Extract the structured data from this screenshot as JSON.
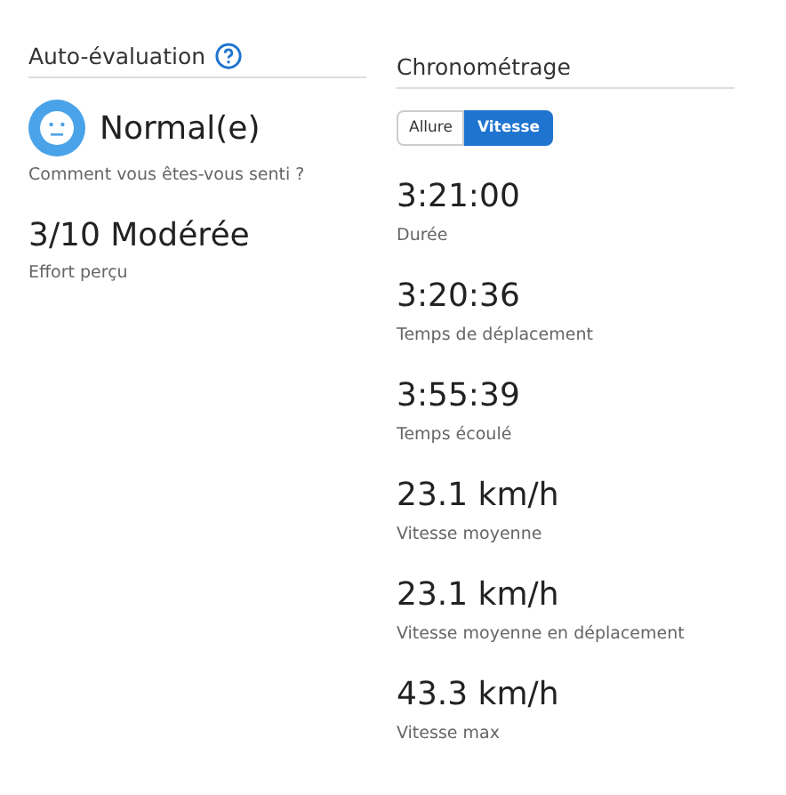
{
  "self_evaluation": {
    "title": "Auto-évaluation",
    "feeling": {
      "value": "Normal(e)",
      "label": "Comment vous êtes-vous senti ?"
    },
    "effort": {
      "value": "3/10 Modérée",
      "label": "Effort perçu"
    }
  },
  "timing": {
    "title": "Chronométrage",
    "toggle": [
      {
        "label": "Allure",
        "selected": false
      },
      {
        "label": "Vitesse",
        "selected": true
      }
    ],
    "stats": [
      {
        "value": "3:21:00",
        "label": "Durée"
      },
      {
        "value": "3:20:36",
        "label": "Temps de déplacement"
      },
      {
        "value": "3:55:39",
        "label": "Temps écoulé"
      },
      {
        "value": "23.1 km/h",
        "label": "Vitesse moyenne"
      },
      {
        "value": "23.1 km/h",
        "label": "Vitesse moyenne en déplacement"
      },
      {
        "value": "43.3 km/h",
        "label": "Vitesse max"
      }
    ]
  }
}
